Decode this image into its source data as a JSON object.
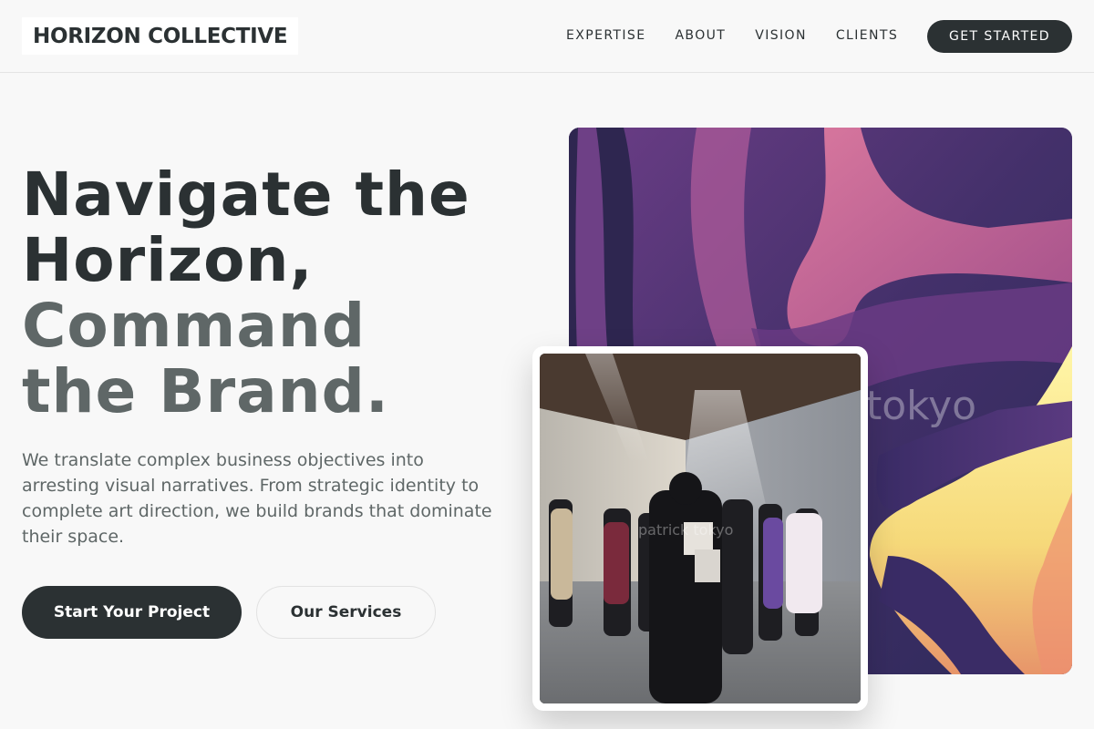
{
  "nav": {
    "logo": "HORIZON COLLECTIVE",
    "links": [
      "EXPERTISE",
      "ABOUT",
      "VISION",
      "CLIENTS"
    ],
    "cta": "GET STARTED"
  },
  "hero": {
    "headline_line1": "Navigate the",
    "headline_line2": "Horizon,",
    "headline_line3": "Command",
    "headline_line4": "the Brand.",
    "subtext": "We translate complex business objectives into arresting visual narratives. From strategic identity to complete art direction, we build brands that dominate their space.",
    "primary_button": "Start Your Project",
    "secondary_button": "Our Services"
  },
  "media": {
    "art_watermark": "tokyo",
    "photo_watermark": "patrick tokyo"
  },
  "colors": {
    "text_dark": "#2b3133",
    "text_muted": "#5f6767",
    "background": "#f8f8f8",
    "button_dark": "#2b3133"
  }
}
